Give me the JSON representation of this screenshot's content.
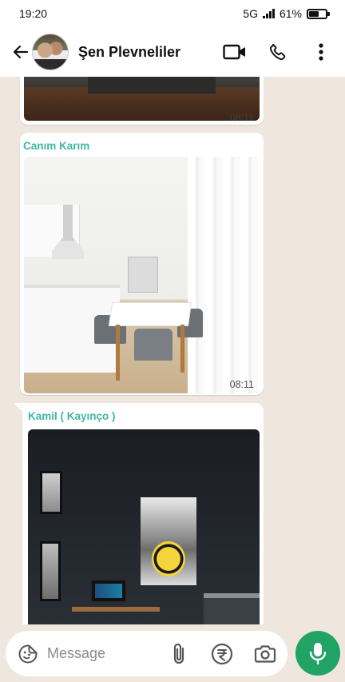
{
  "status_bar": {
    "time": "19:20",
    "network": "5G",
    "battery": "61%",
    "battery_level": 0.61
  },
  "header": {
    "title": "Şen Plevneliler",
    "icons": [
      "back-arrow-icon",
      "video-call-icon",
      "phone-icon",
      "more-vert-icon"
    ]
  },
  "messages": [
    {
      "sender": "",
      "type": "image",
      "description_icon": "photo",
      "time": "08:11"
    },
    {
      "sender": "Canım Karım",
      "type": "image",
      "description_icon": "photo",
      "time": "08:11"
    },
    {
      "sender": "Kamil ( Kayınço )",
      "type": "image",
      "description_icon": "photo",
      "time": ""
    }
  ],
  "composer": {
    "placeholder": "Message",
    "value": "",
    "icons": [
      "sticker-icon",
      "attach-icon",
      "payment-icon",
      "camera-icon",
      "mic-icon"
    ]
  },
  "colors": {
    "accent_green": "#21a366",
    "sender_name": "#3fb6a4",
    "chat_background": "#efe7de"
  }
}
